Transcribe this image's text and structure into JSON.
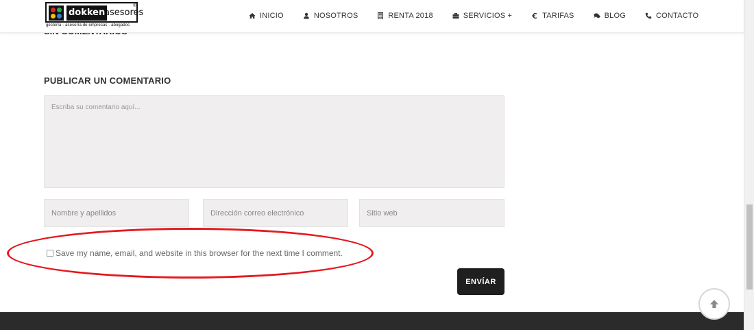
{
  "logo": {
    "word1": "dokken",
    "word2": "asesores",
    "reg": "®",
    "tagline": "gestoría - asesoría de empresas - abogados"
  },
  "nav": {
    "items": [
      {
        "label": "INICIO",
        "icon": "home-icon"
      },
      {
        "label": "NOSOTROS",
        "icon": "user-icon"
      },
      {
        "label": "RENTA 2018",
        "icon": "calculator-icon"
      },
      {
        "label": "SERVICIOS +",
        "icon": "briefcase-icon"
      },
      {
        "label": "TARIFAS",
        "icon": "euro-icon"
      },
      {
        "label": "BLOG",
        "icon": "comments-icon"
      },
      {
        "label": "CONTACTO",
        "icon": "phone-icon"
      }
    ]
  },
  "comments": {
    "cut_heading": "SIN COMENTARIOS",
    "title": "PUBLICAR UN COMENTARIO",
    "comment_placeholder": "Escriba su comentario aquí...",
    "name_placeholder": "Nombre y apellidos",
    "email_placeholder": "Dirección correo electrónico",
    "web_placeholder": "Sitio web",
    "consent_label": "Save my name, email, and website in this browser for the next time I comment.",
    "submit_label": "ENVÍAR"
  },
  "colors": {
    "annotation": "#e4191f",
    "button": "#1f1f1f",
    "footer": "#2b2b2b",
    "field_bg": "#f0eeee"
  }
}
